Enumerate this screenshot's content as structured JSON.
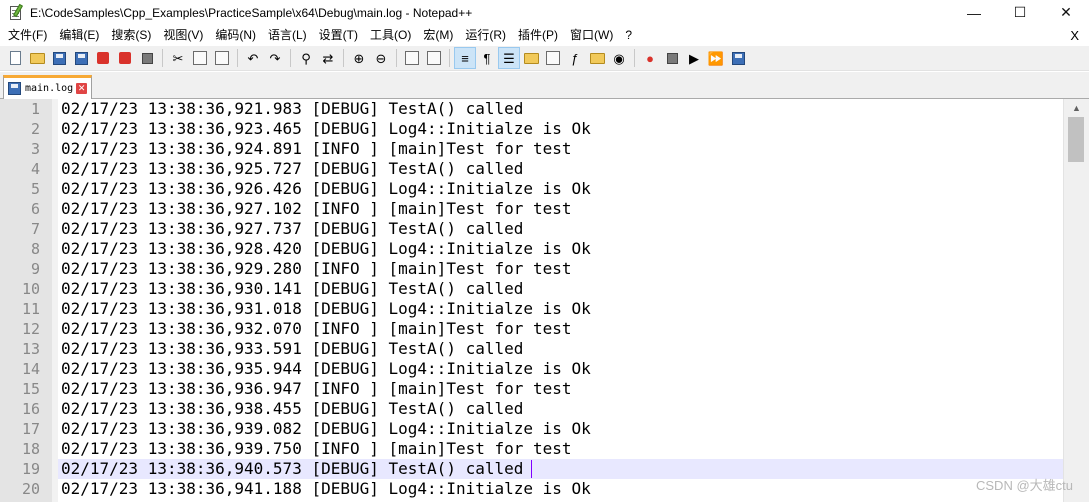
{
  "window": {
    "title": "E:\\CodeSamples\\Cpp_Examples\\PracticeSample\\x64\\Debug\\main.log - Notepad++",
    "minimize": "—",
    "maximize": "☐",
    "close": "✕"
  },
  "menu": {
    "items": [
      "文件(F)",
      "编辑(E)",
      "搜索(S)",
      "视图(V)",
      "编码(N)",
      "语言(L)",
      "设置(T)",
      "工具(O)",
      "宏(M)",
      "运行(R)",
      "插件(P)",
      "窗口(W)",
      "?"
    ],
    "close_label": "X"
  },
  "toolbar": {
    "icons": [
      "new-file-icon",
      "open-file-icon",
      "save-icon",
      "save-all-icon",
      "close-icon",
      "close-all-icon",
      "print-icon",
      "cut-icon",
      "copy-icon",
      "paste-icon",
      "undo-icon",
      "redo-icon",
      "find-icon",
      "replace-icon",
      "zoom-in-icon",
      "zoom-out-icon",
      "sync-vertical-icon",
      "sync-horizontal-icon",
      "word-wrap-icon",
      "show-all-chars-icon",
      "indent-guide-icon",
      "language-icon",
      "doc-map-icon",
      "function-list-icon",
      "folder-workspace-icon",
      "monitoring-icon",
      "record-macro-icon",
      "stop-macro-icon",
      "play-macro-icon",
      "run-macro-multiple-icon",
      "save-macro-icon"
    ]
  },
  "tab": {
    "label": "main.log"
  },
  "editor": {
    "current_line": 19,
    "lines": [
      "02/17/23 13:38:36,921.983 [DEBUG] TestA() called",
      "02/17/23 13:38:36,923.465 [DEBUG] Log4::Initialze is Ok",
      "02/17/23 13:38:36,924.891 [INFO ] [main]Test for test",
      "02/17/23 13:38:36,925.727 [DEBUG] TestA() called",
      "02/17/23 13:38:36,926.426 [DEBUG] Log4::Initialze is Ok",
      "02/17/23 13:38:36,927.102 [INFO ] [main]Test for test",
      "02/17/23 13:38:36,927.737 [DEBUG] TestA() called",
      "02/17/23 13:38:36,928.420 [DEBUG] Log4::Initialze is Ok",
      "02/17/23 13:38:36,929.280 [INFO ] [main]Test for test",
      "02/17/23 13:38:36,930.141 [DEBUG] TestA() called",
      "02/17/23 13:38:36,931.018 [DEBUG] Log4::Initialze is Ok",
      "02/17/23 13:38:36,932.070 [INFO ] [main]Test for test",
      "02/17/23 13:38:36,933.591 [DEBUG] TestA() called",
      "02/17/23 13:38:36,935.944 [DEBUG] Log4::Initialze is Ok",
      "02/17/23 13:38:36,936.947 [INFO ] [main]Test for test",
      "02/17/23 13:38:36,938.455 [DEBUG] TestA() called",
      "02/17/23 13:38:36,939.082 [DEBUG] Log4::Initialze is Ok",
      "02/17/23 13:38:36,939.750 [INFO ] [main]Test for test",
      "02/17/23 13:38:36,940.573 [DEBUG] TestA() called",
      "02/17/23 13:38:36,941.188 [DEBUG] Log4::Initialze is Ok"
    ]
  },
  "scrollbar": {
    "up": "▲",
    "down": "▼"
  },
  "watermark": "CSDN @大雄ctu",
  "colors": {
    "tab_accent": "#f7a935",
    "current_line_bg": "#e8e8ff",
    "caret": "#8000ff",
    "gutter_bg": "#e4e4e4"
  }
}
